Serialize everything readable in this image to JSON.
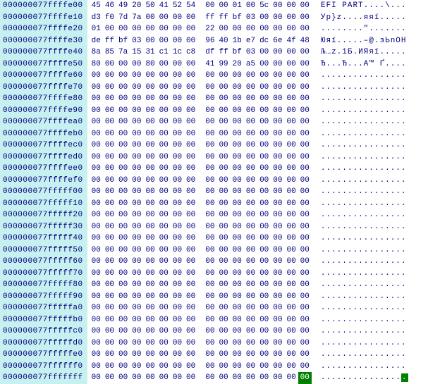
{
  "rows": [
    {
      "offset": "000000077ffffe00",
      "b": [
        "45",
        "46",
        "49",
        "20",
        "50",
        "41",
        "52",
        "54",
        "00",
        "00",
        "01",
        "00",
        "5c",
        "00",
        "00",
        "00"
      ],
      "ascii": "EFI PART....\\..."
    },
    {
      "offset": "000000077ffffe10",
      "b": [
        "d3",
        "f0",
        "7d",
        "7a",
        "00",
        "00",
        "00",
        "00",
        "ff",
        "ff",
        "bf",
        "03",
        "00",
        "00",
        "00",
        "00"
      ],
      "ascii": "Ур}z....яяї....."
    },
    {
      "offset": "000000077ffffe20",
      "b": [
        "01",
        "00",
        "00",
        "00",
        "00",
        "00",
        "00",
        "00",
        "22",
        "00",
        "00",
        "00",
        "00",
        "00",
        "00",
        "00"
      ],
      "ascii": "........\"......."
    },
    {
      "offset": "000000077ffffe30",
      "b": [
        "de",
        "ff",
        "bf",
        "03",
        "00",
        "00",
        "00",
        "00",
        "96",
        "40",
        "1b",
        "e7",
        "dc",
        "6e",
        "4f",
        "48"
      ],
      "ascii": "Юяї.....–@.зЬnOH"
    },
    {
      "offset": "000000077ffffe40",
      "b": [
        "8a",
        "85",
        "7a",
        "15",
        "31",
        "c1",
        "1c",
        "c8",
        "df",
        "ff",
        "bf",
        "03",
        "00",
        "00",
        "00",
        "00"
      ],
      "ascii": "Љ…z.1Б.ИЯяї....."
    },
    {
      "offset": "000000077ffffe50",
      "b": [
        "80",
        "00",
        "00",
        "00",
        "80",
        "00",
        "00",
        "00",
        "41",
        "99",
        "20",
        "a5",
        "00",
        "00",
        "00",
        "00"
      ],
      "ascii": "Ђ...Ђ...A™ Ґ...."
    },
    {
      "offset": "000000077ffffe60",
      "b": [
        "00",
        "00",
        "00",
        "00",
        "00",
        "00",
        "00",
        "00",
        "00",
        "00",
        "00",
        "00",
        "00",
        "00",
        "00",
        "00"
      ],
      "ascii": "................"
    },
    {
      "offset": "000000077ffffe70",
      "b": [
        "00",
        "00",
        "00",
        "00",
        "00",
        "00",
        "00",
        "00",
        "00",
        "00",
        "00",
        "00",
        "00",
        "00",
        "00",
        "00"
      ],
      "ascii": "................"
    },
    {
      "offset": "000000077ffffe80",
      "b": [
        "00",
        "00",
        "00",
        "00",
        "00",
        "00",
        "00",
        "00",
        "00",
        "00",
        "00",
        "00",
        "00",
        "00",
        "00",
        "00"
      ],
      "ascii": "................"
    },
    {
      "offset": "000000077ffffe90",
      "b": [
        "00",
        "00",
        "00",
        "00",
        "00",
        "00",
        "00",
        "00",
        "00",
        "00",
        "00",
        "00",
        "00",
        "00",
        "00",
        "00"
      ],
      "ascii": "................"
    },
    {
      "offset": "000000077ffffea0",
      "b": [
        "00",
        "00",
        "00",
        "00",
        "00",
        "00",
        "00",
        "00",
        "00",
        "00",
        "00",
        "00",
        "00",
        "00",
        "00",
        "00"
      ],
      "ascii": "................"
    },
    {
      "offset": "000000077ffffeb0",
      "b": [
        "00",
        "00",
        "00",
        "00",
        "00",
        "00",
        "00",
        "00",
        "00",
        "00",
        "00",
        "00",
        "00",
        "00",
        "00",
        "00"
      ],
      "ascii": "................"
    },
    {
      "offset": "000000077ffffec0",
      "b": [
        "00",
        "00",
        "00",
        "00",
        "00",
        "00",
        "00",
        "00",
        "00",
        "00",
        "00",
        "00",
        "00",
        "00",
        "00",
        "00"
      ],
      "ascii": "................"
    },
    {
      "offset": "000000077ffffed0",
      "b": [
        "00",
        "00",
        "00",
        "00",
        "00",
        "00",
        "00",
        "00",
        "00",
        "00",
        "00",
        "00",
        "00",
        "00",
        "00",
        "00"
      ],
      "ascii": "................"
    },
    {
      "offset": "000000077ffffee0",
      "b": [
        "00",
        "00",
        "00",
        "00",
        "00",
        "00",
        "00",
        "00",
        "00",
        "00",
        "00",
        "00",
        "00",
        "00",
        "00",
        "00"
      ],
      "ascii": "................"
    },
    {
      "offset": "000000077ffffef0",
      "b": [
        "00",
        "00",
        "00",
        "00",
        "00",
        "00",
        "00",
        "00",
        "00",
        "00",
        "00",
        "00",
        "00",
        "00",
        "00",
        "00"
      ],
      "ascii": "................"
    },
    {
      "offset": "000000077fffff00",
      "b": [
        "00",
        "00",
        "00",
        "00",
        "00",
        "00",
        "00",
        "00",
        "00",
        "00",
        "00",
        "00",
        "00",
        "00",
        "00",
        "00"
      ],
      "ascii": "................"
    },
    {
      "offset": "000000077fffff10",
      "b": [
        "00",
        "00",
        "00",
        "00",
        "00",
        "00",
        "00",
        "00",
        "00",
        "00",
        "00",
        "00",
        "00",
        "00",
        "00",
        "00"
      ],
      "ascii": "................"
    },
    {
      "offset": "000000077fffff20",
      "b": [
        "00",
        "00",
        "00",
        "00",
        "00",
        "00",
        "00",
        "00",
        "00",
        "00",
        "00",
        "00",
        "00",
        "00",
        "00",
        "00"
      ],
      "ascii": "................"
    },
    {
      "offset": "000000077fffff30",
      "b": [
        "00",
        "00",
        "00",
        "00",
        "00",
        "00",
        "00",
        "00",
        "00",
        "00",
        "00",
        "00",
        "00",
        "00",
        "00",
        "00"
      ],
      "ascii": "................"
    },
    {
      "offset": "000000077fffff40",
      "b": [
        "00",
        "00",
        "00",
        "00",
        "00",
        "00",
        "00",
        "00",
        "00",
        "00",
        "00",
        "00",
        "00",
        "00",
        "00",
        "00"
      ],
      "ascii": "................"
    },
    {
      "offset": "000000077fffff50",
      "b": [
        "00",
        "00",
        "00",
        "00",
        "00",
        "00",
        "00",
        "00",
        "00",
        "00",
        "00",
        "00",
        "00",
        "00",
        "00",
        "00"
      ],
      "ascii": "................"
    },
    {
      "offset": "000000077fffff60",
      "b": [
        "00",
        "00",
        "00",
        "00",
        "00",
        "00",
        "00",
        "00",
        "00",
        "00",
        "00",
        "00",
        "00",
        "00",
        "00",
        "00"
      ],
      "ascii": "................"
    },
    {
      "offset": "000000077fffff70",
      "b": [
        "00",
        "00",
        "00",
        "00",
        "00",
        "00",
        "00",
        "00",
        "00",
        "00",
        "00",
        "00",
        "00",
        "00",
        "00",
        "00"
      ],
      "ascii": "................"
    },
    {
      "offset": "000000077fffff80",
      "b": [
        "00",
        "00",
        "00",
        "00",
        "00",
        "00",
        "00",
        "00",
        "00",
        "00",
        "00",
        "00",
        "00",
        "00",
        "00",
        "00"
      ],
      "ascii": "................"
    },
    {
      "offset": "000000077fffff90",
      "b": [
        "00",
        "00",
        "00",
        "00",
        "00",
        "00",
        "00",
        "00",
        "00",
        "00",
        "00",
        "00",
        "00",
        "00",
        "00",
        "00"
      ],
      "ascii": "................"
    },
    {
      "offset": "000000077fffffa0",
      "b": [
        "00",
        "00",
        "00",
        "00",
        "00",
        "00",
        "00",
        "00",
        "00",
        "00",
        "00",
        "00",
        "00",
        "00",
        "00",
        "00"
      ],
      "ascii": "................"
    },
    {
      "offset": "000000077fffffb0",
      "b": [
        "00",
        "00",
        "00",
        "00",
        "00",
        "00",
        "00",
        "00",
        "00",
        "00",
        "00",
        "00",
        "00",
        "00",
        "00",
        "00"
      ],
      "ascii": "................"
    },
    {
      "offset": "000000077fffffc0",
      "b": [
        "00",
        "00",
        "00",
        "00",
        "00",
        "00",
        "00",
        "00",
        "00",
        "00",
        "00",
        "00",
        "00",
        "00",
        "00",
        "00"
      ],
      "ascii": "................"
    },
    {
      "offset": "000000077fffffd0",
      "b": [
        "00",
        "00",
        "00",
        "00",
        "00",
        "00",
        "00",
        "00",
        "00",
        "00",
        "00",
        "00",
        "00",
        "00",
        "00",
        "00"
      ],
      "ascii": "................"
    },
    {
      "offset": "000000077fffffe0",
      "b": [
        "00",
        "00",
        "00",
        "00",
        "00",
        "00",
        "00",
        "00",
        "00",
        "00",
        "00",
        "00",
        "00",
        "00",
        "00",
        "00"
      ],
      "ascii": "................"
    },
    {
      "offset": "000000077ffffff0",
      "b": [
        "00",
        "00",
        "00",
        "00",
        "00",
        "00",
        "00",
        "00",
        "00",
        "00",
        "00",
        "00",
        "00",
        "00",
        "00",
        "00"
      ],
      "ascii": "................"
    }
  ],
  "last_row": {
    "offset": "000000077fffffff",
    "b": [
      "00",
      "00",
      "00",
      "00",
      "00",
      "00",
      "00",
      "00",
      "00",
      "00",
      "00",
      "00",
      "00",
      "00",
      "00"
    ],
    "cursor_byte": "00",
    "ascii_prefix": "...............",
    "ascii_cursor": "."
  }
}
